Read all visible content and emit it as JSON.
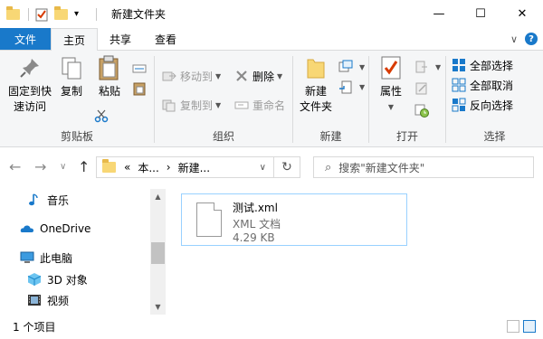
{
  "window": {
    "title": "新建文件夹",
    "controls": {
      "minimize": "—",
      "maximize": "☐",
      "close": "✕"
    },
    "quick_access_caret": "▾"
  },
  "ribbon_tabs": {
    "file": "文件",
    "items": [
      "主页",
      "共享",
      "查看"
    ],
    "active": "主页",
    "collapse_glyph": "∨",
    "help": "?"
  },
  "ribbon": {
    "clipboard": {
      "label": "剪贴板",
      "pin": "固定到快\n速访问",
      "pin_line1": "固定到快",
      "pin_line2": "速访问",
      "copy": "复制",
      "paste": "粘贴"
    },
    "organize": {
      "label": "组织",
      "move_to": "移动到",
      "copy_to": "复制到",
      "delete": "删除",
      "rename": "重命名"
    },
    "new": {
      "label": "新建",
      "new_folder_line1": "新建",
      "new_folder_line2": "文件夹"
    },
    "open": {
      "label": "打开",
      "properties": "属性"
    },
    "select": {
      "label": "选择",
      "select_all": "全部选择",
      "select_none": "全部取消",
      "invert": "反向选择"
    }
  },
  "navigation": {
    "back": "←",
    "forward": "→",
    "recent": "∨",
    "up": "↑",
    "address_overflow": "«",
    "address_parts": [
      "本...",
      "新建..."
    ],
    "address_sep": "›",
    "address_dropdown": "∨",
    "refresh": "↻",
    "search_placeholder": "搜索\"新建文件夹\""
  },
  "nav_pane": {
    "items": [
      {
        "label": "音乐",
        "icon": "music-icon"
      },
      {
        "label": "OneDrive",
        "icon": "cloud-icon"
      },
      {
        "label": "此电脑",
        "icon": "computer-icon"
      },
      {
        "label": "3D 对象",
        "icon": "cube-icon"
      },
      {
        "label": "视频",
        "icon": "video-icon"
      }
    ],
    "scroll_up": "▲",
    "scroll_down": "▼"
  },
  "files": [
    {
      "name": "测试.xml",
      "type": "XML 文档",
      "size": "4.29 KB"
    }
  ],
  "status": {
    "item_count": "1 个项目"
  },
  "colors": {
    "accent": "#1979ca",
    "selection_border": "#99d1ff",
    "ribbon_bg": "#f5f6f7",
    "folder": "#f8d775"
  }
}
